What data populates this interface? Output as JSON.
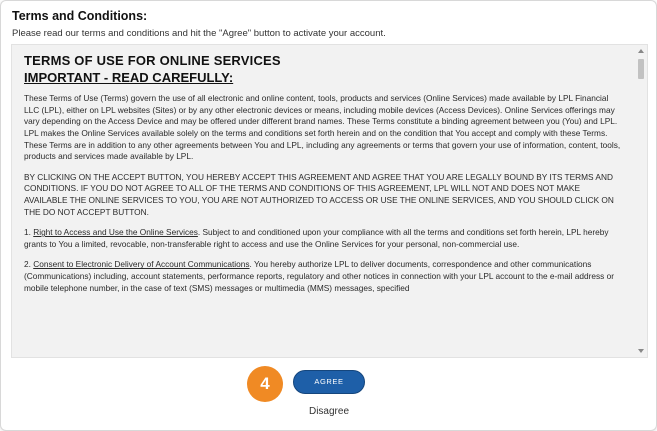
{
  "header": {
    "title": "Terms and Conditions:",
    "subtitle": "Please read our terms and conditions and hit the \"Agree\" button to activate your account."
  },
  "tos": {
    "heading": "TERMS OF USE FOR ONLINE SERVICES",
    "subheading": "IMPORTANT - READ CAREFULLY:",
    "para1": "These Terms of Use (Terms) govern the use of all electronic and online content, tools, products and services (Online Services) made available by LPL Financial LLC (LPL), either on LPL websites (Sites) or by any other electronic devices or means, including mobile devices (Access Devices). Online Services offerings may vary depending on the Access Device and may be offered under different brand names. These Terms constitute a binding agreement between you (You) and LPL. LPL makes the Online Services available solely on the terms and conditions set forth herein and on the condition that You accept and comply with these Terms. These Terms are in addition to any other agreements between You and LPL, including any agreements or terms that govern your use of information, content, tools, products and services made available by LPL.",
    "para2": "BY CLICKING ON THE ACCEPT BUTTON, YOU HEREBY ACCEPT THIS AGREEMENT AND AGREE THAT YOU ARE LEGALLY BOUND BY ITS TERMS AND CONDITIONS. IF YOU DO NOT AGREE TO ALL OF THE TERMS AND CONDITIONS OF THIS AGREEMENT, LPL WILL NOT AND DOES NOT MAKE AVAILABLE THE ONLINE SERVICES TO YOU, YOU ARE NOT AUTHORIZED TO ACCESS OR USE THE ONLINE SERVICES, AND YOU SHOULD CLICK ON THE DO NOT ACCEPT BUTTON.",
    "para3_num": "1. ",
    "para3_title": "Right to Access and Use the Online Services",
    "para3_body": ". Subject to and conditioned upon your compliance with all the terms and conditions set forth herein, LPL hereby grants to You a limited, revocable, non-transferable right to access and use the Online Services for your personal, non-commercial use.",
    "para4_num": "2. ",
    "para4_title": "Consent to Electronic Delivery of Account Communications",
    "para4_body": ". You hereby authorize LPL to deliver documents, correspondence and other communications (Communications) including, account statements, performance reports, regulatory and other notices in connection with your LPL account to the e-mail address or mobile telephone number, in the case of text (SMS) messages or multimedia (MMS) messages, specified"
  },
  "step_badge": "4",
  "buttons": {
    "agree": "AGREE",
    "disagree": "Disagree"
  },
  "colors": {
    "agree_button": "#1e5fa8",
    "badge": "#f08a24",
    "tos_background": "#f2f2f2"
  }
}
